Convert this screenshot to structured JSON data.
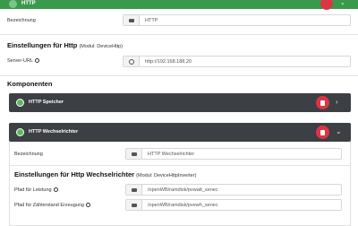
{
  "header": {
    "title": "HTTP"
  },
  "general": {
    "bezeichnung_label": "Bezeichnung",
    "bezeichnung_value": "HTTP",
    "settings_heading": "Einstellungen für Http",
    "settings_module": "(Modul: DeviceHttp)",
    "server_url_label": "Server-URL",
    "server_url_value": "http://192.168.188.20"
  },
  "components": {
    "heading": "Komponenten",
    "items": [
      {
        "title": "HTTP Speicher"
      },
      {
        "title": "HTTP Wechselrichter"
      }
    ]
  },
  "inverter": {
    "bezeichnung_label": "Bezeichnung",
    "bezeichnung_value": "HTTP Wechselrichter",
    "settings_heading": "Einstellungen für Http Wechselrichter",
    "settings_module": "(Modul: DeviceHttpInverter)",
    "power_path_label": "Pfad für Leistung",
    "power_path_value": "/openWB/ramdisk/pvwatt_senec",
    "counter_path_label": "Pfad für Zählerstand Erzeugung",
    "counter_path_value": "/openWB/ramdisk/pvewh_senec"
  },
  "colors": {
    "accent": "#3a9a4c",
    "danger": "#dc3545",
    "dark_header": "#3c3f44"
  },
  "icons": [
    "card-icon",
    "globe-icon",
    "trash-icon",
    "chevron-right-icon",
    "chevron-down-icon",
    "help-icon"
  ]
}
